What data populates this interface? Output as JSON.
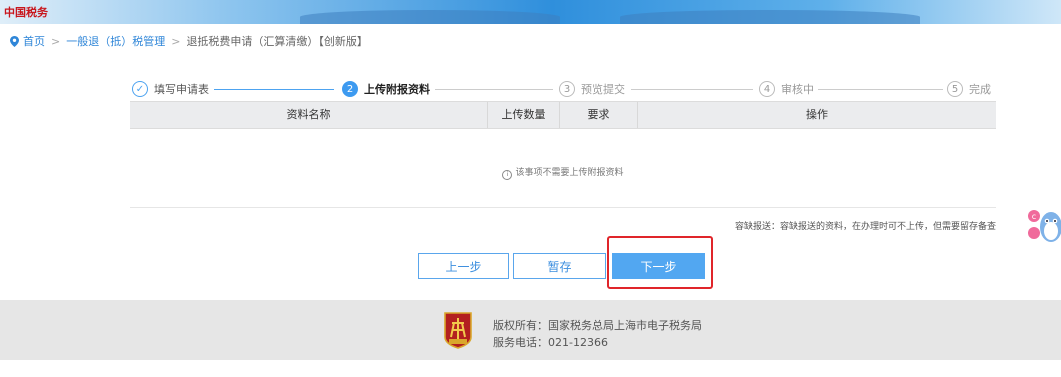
{
  "banner": {
    "logo_text": "中国税务"
  },
  "breadcrumb": {
    "items": [
      "首页",
      "一般退（抵）税管理",
      "退抵税费申请（汇算清缴）【创新版】"
    ],
    "separator": ">"
  },
  "steps": [
    {
      "num": "✓",
      "label": "填写申请表",
      "state": "done"
    },
    {
      "num": "2",
      "label": "上传附报资料",
      "state": "active"
    },
    {
      "num": "3",
      "label": "预览提交",
      "state": "todo"
    },
    {
      "num": "4",
      "label": "审核中",
      "state": "todo"
    },
    {
      "num": "5",
      "label": "完成",
      "state": "todo"
    }
  ],
  "table": {
    "headers": [
      "资料名称",
      "上传数量",
      "要求",
      "操作"
    ],
    "empty_text": "该事项不需要上传附报资料"
  },
  "note": "容缺报送：容缺报送的资料，在办理时可不上传，但需要留存备查",
  "buttons": {
    "prev": "上一步",
    "save": "暂存",
    "next": "下一步"
  },
  "footer": {
    "badge_text": "税徽",
    "copyright": "版权所有：国家税务总局上海市电子税务局",
    "phone": "服务电话：021-12366"
  },
  "colors": {
    "accent": "#3d9af0",
    "highlight": "#e0252a",
    "footer_bg": "#e6e6e6"
  }
}
